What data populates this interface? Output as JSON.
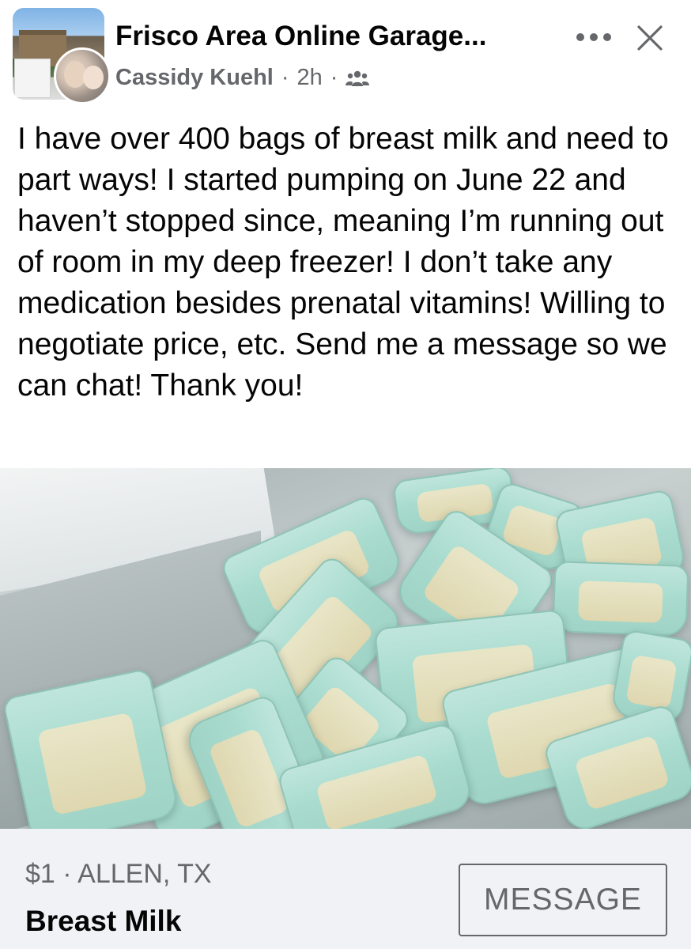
{
  "header": {
    "group_name": "Frisco Area Online Garage...",
    "author": "Cassidy Kuehl",
    "separator": "·",
    "time": "2h",
    "audience_icon": "group-audience-icon",
    "more_icon": "more-options-icon",
    "close_icon": "close-icon"
  },
  "post": {
    "text": "I have over 400 bags of breast milk and need to part ways! I started pumping on June 22 and haven’t stopped since, meaning I’m running out of room in my deep freezer! I don’t take any medication besides prenatal vitamins! Willing to negotiate price, etc. Send me a message so we can chat! Thank you!"
  },
  "listing": {
    "price_location": "$1 · ALLEN, TX",
    "title": "Breast Milk",
    "message_button": "MESSAGE"
  },
  "colors": {
    "text_primary": "#050505",
    "text_secondary": "#65676b",
    "footer_bg": "#f0f2f5"
  }
}
